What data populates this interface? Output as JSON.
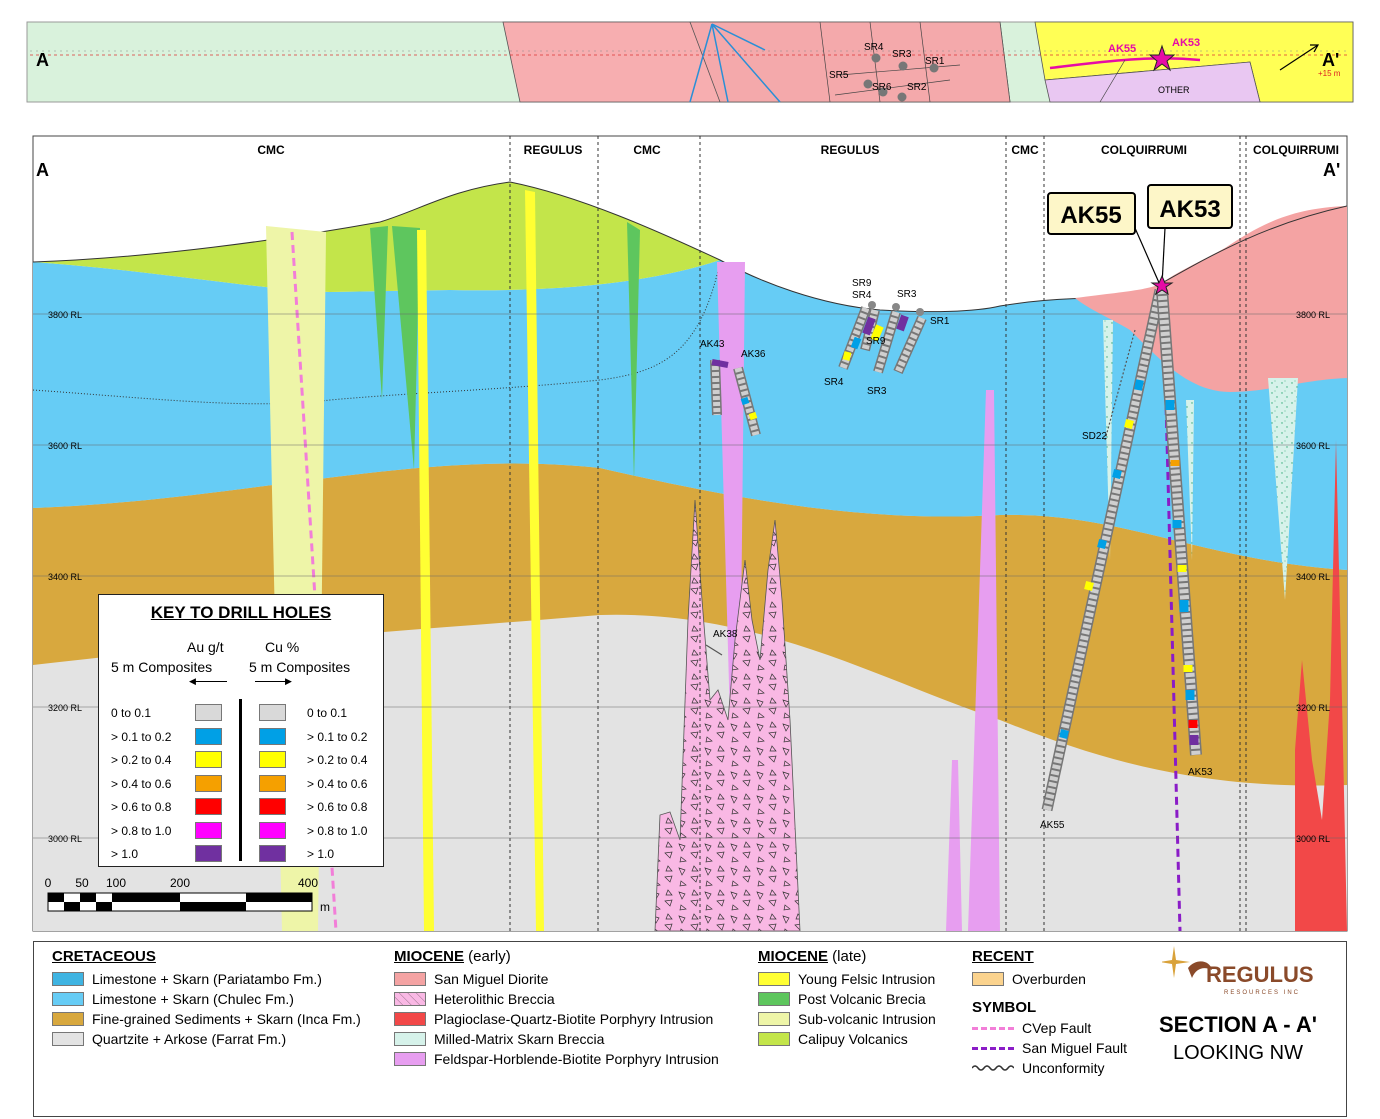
{
  "plan_view": {
    "left_label": "A",
    "right_label": "A'",
    "offset_note": "+15 m",
    "holes": [
      "AK55",
      "AK53"
    ],
    "sr_labels": [
      "SR4",
      "SR3",
      "SR1",
      "SR5",
      "SR6",
      "SR2"
    ],
    "other_label": "OTHER"
  },
  "section": {
    "left_label": "A",
    "right_label": "A'",
    "zones": [
      "CMC",
      "REGULUS",
      "CMC",
      "REGULUS",
      "CMC",
      "COLQUIRRUMI",
      "COLQUIRRUMI"
    ],
    "elevations": [
      "3800 RL",
      "3600 RL",
      "3400 RL",
      "3200 RL",
      "3000 RL"
    ],
    "callouts": [
      "AK55",
      "AK53"
    ],
    "hole_labels": {
      "ak43": "AK43",
      "ak36": "AK36",
      "ak38": "AK38",
      "sd22": "SD22",
      "ak55": "AK55",
      "ak53": "AK53",
      "sr9a": "SR9",
      "sr4a": "SR4",
      "sr3a": "SR3",
      "sr1": "SR1",
      "sr9b": "SR9",
      "sr4b": "SR4",
      "sr3b": "SR3"
    },
    "scale": {
      "ticks": [
        "0",
        "50",
        "100",
        "200",
        "400"
      ],
      "unit": "m"
    }
  },
  "key": {
    "title": "KEY TO DRILL HOLES",
    "au_label": "Au g/t",
    "au_sub": "5 m Composites",
    "cu_label": "Cu %",
    "cu_sub": "5 m Composites",
    "rows": [
      {
        "label": "0 to 0.1",
        "color": "#d9d9d9"
      },
      {
        "label": "> 0.1 to 0.2",
        "color": "#00a0e6"
      },
      {
        "label": "> 0.2 to 0.4",
        "color": "#ffff00"
      },
      {
        "label": "> 0.4 to 0.6",
        "color": "#f5a000"
      },
      {
        "label": "> 0.6 to 0.8",
        "color": "#ff0000"
      },
      {
        "label": "> 0.8 to 1.0",
        "color": "#ff00ff"
      },
      {
        "label": "> 1.0",
        "color": "#7030a0"
      }
    ]
  },
  "legend": {
    "cretaceous": {
      "title": "CRETACEOUS",
      "items": [
        {
          "label": "Limestone + Skarn (Pariatambo Fm.)",
          "color": "#3fb4e2"
        },
        {
          "label": "Limestone + Skarn (Chulec Fm.)",
          "color": "#66ccf5"
        },
        {
          "label": "Fine-grained Sediments + Skarn (Inca Fm.)",
          "color": "#d8a83e"
        },
        {
          "label": "Quartzite + Arkose (Farrat Fm.)",
          "color": "#e3e3e3"
        }
      ]
    },
    "miocene_early": {
      "title": "MIOCENE",
      "subtitle": " (early)",
      "items": [
        {
          "label": "San Miguel Diorite",
          "color": "#f4a3a3"
        },
        {
          "label": "Heterolithic Breccia",
          "color": "#f9b8e4"
        },
        {
          "label": "Plagioclase-Quartz-Biotite Porphyry Intrusion",
          "color": "#f24848"
        },
        {
          "label": "Milled-Matrix Skarn Breccia",
          "color": "#d6f2ea"
        },
        {
          "label": "Feldspar-Horblende-Biotite Porphyry Intrusion",
          "color": "#e79ef0"
        }
      ]
    },
    "miocene_late": {
      "title": "MIOCENE",
      "subtitle": " (late)",
      "items": [
        {
          "label": "Young Felsic Intrusion",
          "color": "#ffff33"
        },
        {
          "label": "Post Volcanic Brecia",
          "color": "#5ec65e"
        },
        {
          "label": "Sub-volcanic Intrusion",
          "color": "#eef5a8"
        },
        {
          "label": "Calipuy Volcanics",
          "color": "#c3e54a"
        }
      ]
    },
    "recent": {
      "title": "RECENT",
      "items": [
        {
          "label": "Overburden",
          "color": "#fbd38e"
        }
      ]
    },
    "symbol": {
      "title": "SYMBOL",
      "items": [
        {
          "label": "CVep Fault",
          "color": "#f27ed8",
          "style": "dashed"
        },
        {
          "label": "San Miguel Fault",
          "color": "#8a1cc7",
          "style": "dashed"
        },
        {
          "label": "Unconformity",
          "color": "#333333",
          "style": "wavy"
        }
      ]
    },
    "logo": {
      "name": "REGULUS",
      "tagline": "RESOURCES INC"
    },
    "section_title": "SECTION A - A'",
    "section_subtitle": "LOOKING NW"
  }
}
